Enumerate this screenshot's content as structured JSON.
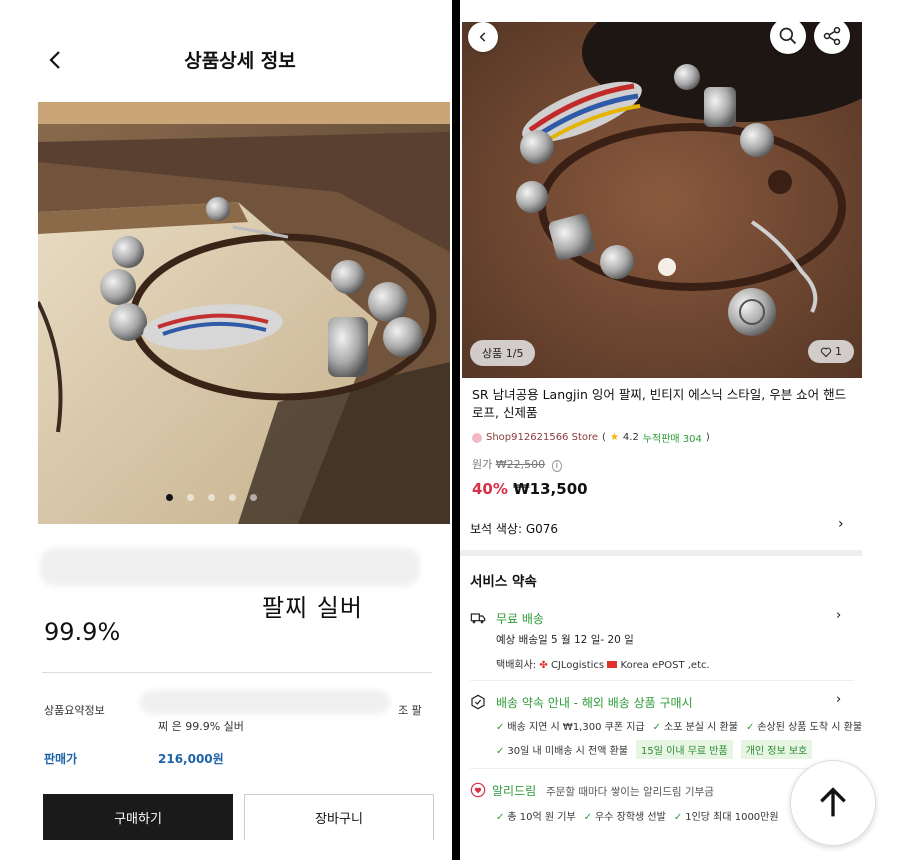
{
  "left": {
    "header_title": "상품상세 정보",
    "product_name": "팔찌 실버",
    "purity": "99.9%",
    "summary_label": "상품요약정보",
    "summary_right": "조 팔",
    "summary_text": "찌 은 99.9% 실버",
    "price_label": "판매가",
    "price_value": "216,000원",
    "buy_label": "구매하기",
    "cart_label": "장바구니",
    "carousel": {
      "count": 5,
      "active": 1
    }
  },
  "right": {
    "image_counter": "상품 1/5",
    "like_count": "1",
    "title": "SR 남녀공용 Langjin 잉어 팔찌, 빈티지 에스닉 스타일, 우븐 쇼어 핸드로프, 신제품",
    "store": "Shop912621566 Store",
    "rating": "4.2",
    "sales": "누적판매 304",
    "orig_label": "원가",
    "orig_price": "₩22,500",
    "discount": "40%",
    "price": "₩13,500",
    "option": "보석 색상: G076",
    "service_title": "서비스 약속",
    "shipping": {
      "title": "무료 배송",
      "eta": "예상 배송일 5 월 12 일- 20 일",
      "carrier_label": "택배회사:",
      "carrier1": "CJLogistics",
      "carrier2": "Korea ePOST ,etc."
    },
    "promise": {
      "title": "배송 약속 안내 - 해외 배송 상품 구매시",
      "tags_row1": [
        "배송 지연 시 ₩1,300 쿠폰 지급",
        "소포 분실 시 환불",
        "손상된 상품 도착 시 환불"
      ],
      "tags_row2": [
        "30일 내 미배송 시 전액 환불"
      ],
      "highlight1": "15일 이내 무료 반품",
      "highlight2": "개인 정보 보호"
    },
    "dream": {
      "title": "알리드림",
      "sub": "주문할 때마다 쌓이는 알리드림 기부금",
      "tags": [
        "총 10억 원 기부",
        "우수 장학생 선발",
        "1인당 최대 1000만원"
      ]
    }
  },
  "colors": {
    "price_blue": "#1e63a8",
    "discount_red": "#d93049",
    "service_green": "#2e9c3a",
    "buy_black": "#1a1a1a"
  },
  "icons": [
    "back-icon",
    "search-icon",
    "share-icon",
    "heart-icon",
    "star-icon",
    "truck-icon",
    "shield-icon",
    "heart-coin-icon",
    "chevron-right-icon",
    "arrow-up-icon"
  ]
}
